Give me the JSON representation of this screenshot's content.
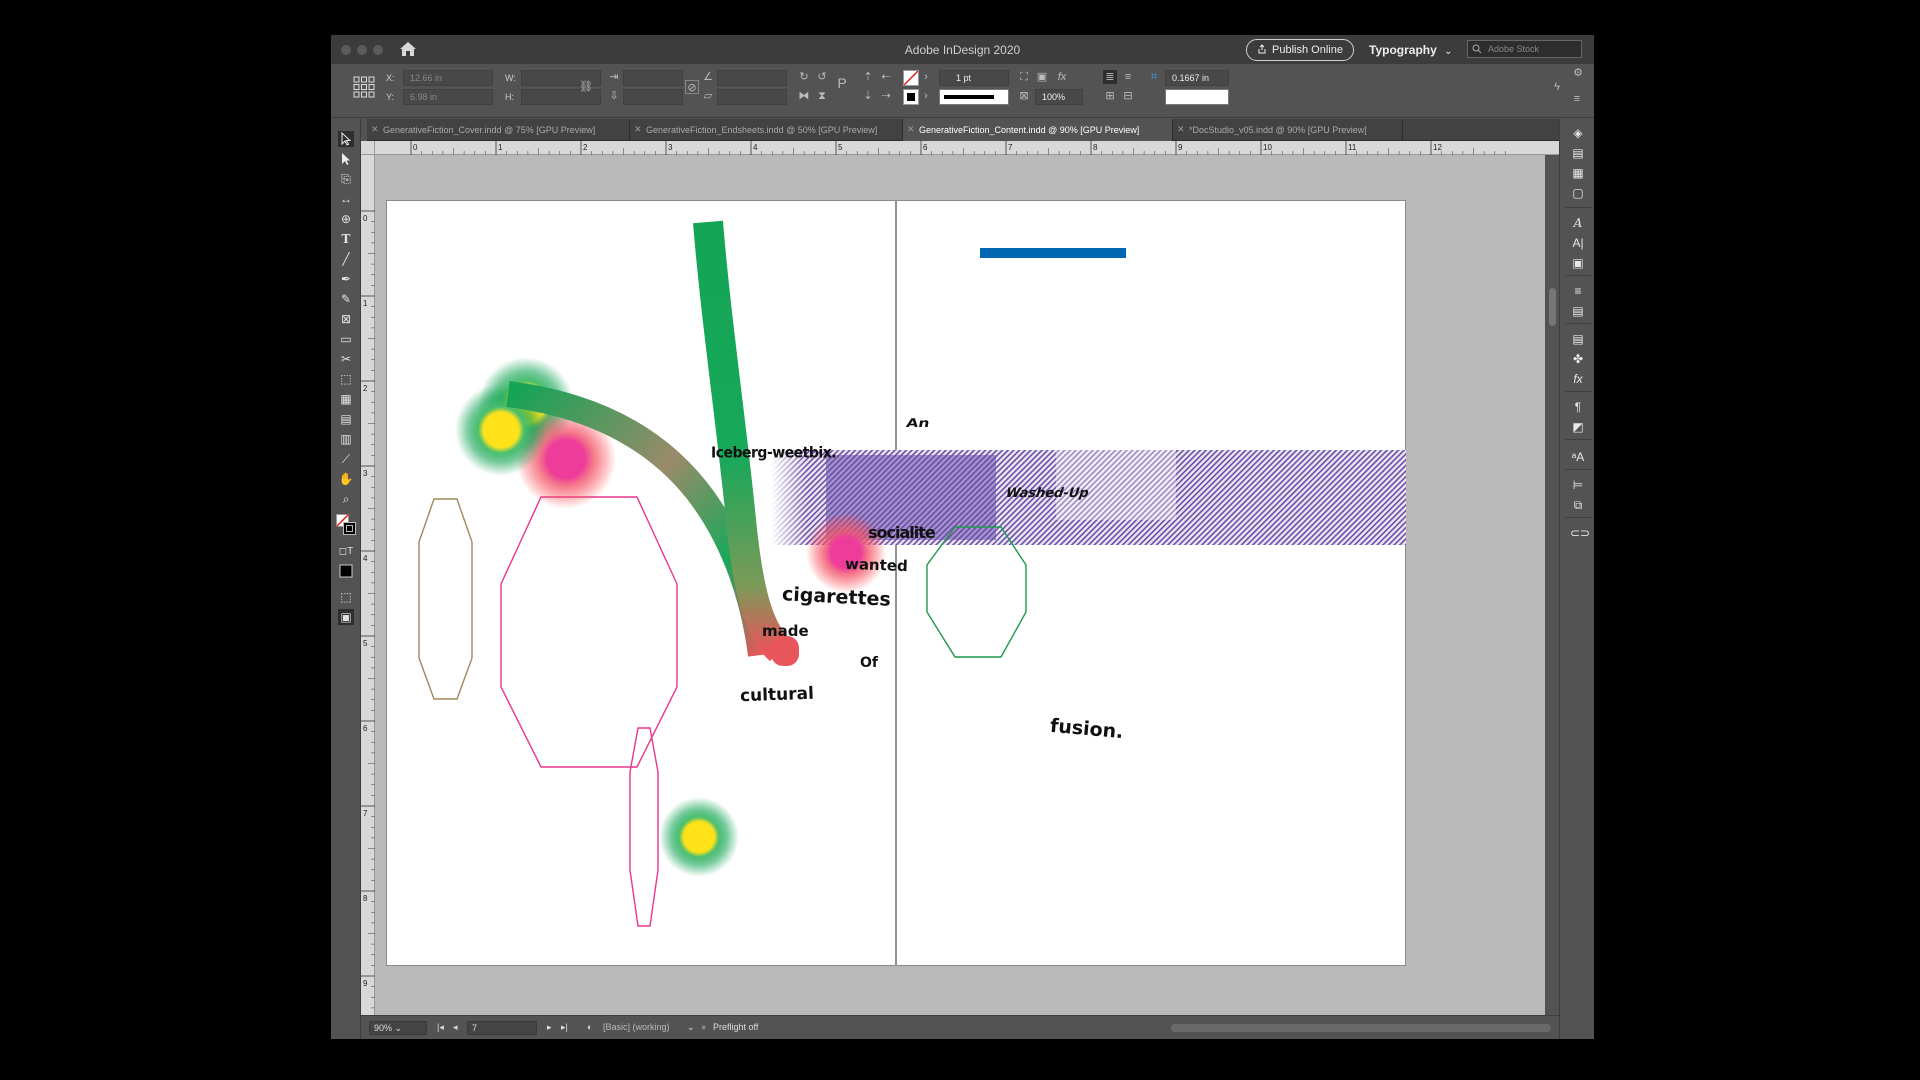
{
  "window": {
    "title": "Adobe InDesign 2020"
  },
  "header": {
    "publish_label": "Publish Online",
    "workspace_label": "Typography",
    "stock_placeholder": "Adobe Stock"
  },
  "control": {
    "x_label": "X:",
    "x_value": "12.66 in",
    "y_label": "Y:",
    "y_value": "6.98 in",
    "w_label": "W:",
    "h_label": "H:",
    "stroke_weight": "1 pt",
    "scale_value": "100%",
    "inset_value": "0.1667 in"
  },
  "tabs": [
    {
      "label": "GenerativeFiction_Cover.indd @ 75% [GPU Preview]"
    },
    {
      "label": "GenerativeFiction_Endsheets.indd @ 50% [GPU Preview]"
    },
    {
      "label": "GenerativeFiction_Content.indd @ 90% [GPU Preview]"
    },
    {
      "label": "*DocStudio_v05.indd @ 90% [GPU Preview]"
    }
  ],
  "ruler": {
    "h_ticks": [
      "0",
      "1",
      "2",
      "3",
      "4",
      "5",
      "6",
      "7",
      "8",
      "9",
      "10",
      "11",
      "12"
    ],
    "v_ticks": [
      "0",
      "1",
      "2",
      "3",
      "4",
      "5",
      "6",
      "7",
      "8",
      "9"
    ]
  },
  "status": {
    "zoom": "90%",
    "page": "7",
    "profile": "[Basic] (working)",
    "preflight": "Preflight off"
  },
  "artwork": {
    "words": {
      "an": "An",
      "iceberg": "Iceberg-weetbix.",
      "washed": "Washed-Up",
      "socialite": "socialite",
      "wanted": "wanted",
      "cigarettes": "cigarettes",
      "made": "made",
      "of": "Of",
      "cultural": "cultural",
      "fusion": "fusion."
    },
    "colors": {
      "green": "#13a456",
      "pink": "#e8368f",
      "brown": "#a08a5a",
      "octagon_green": "#1f9a4a",
      "blue_bar": "#0068b3",
      "purple_band": "#7a5cae"
    }
  }
}
